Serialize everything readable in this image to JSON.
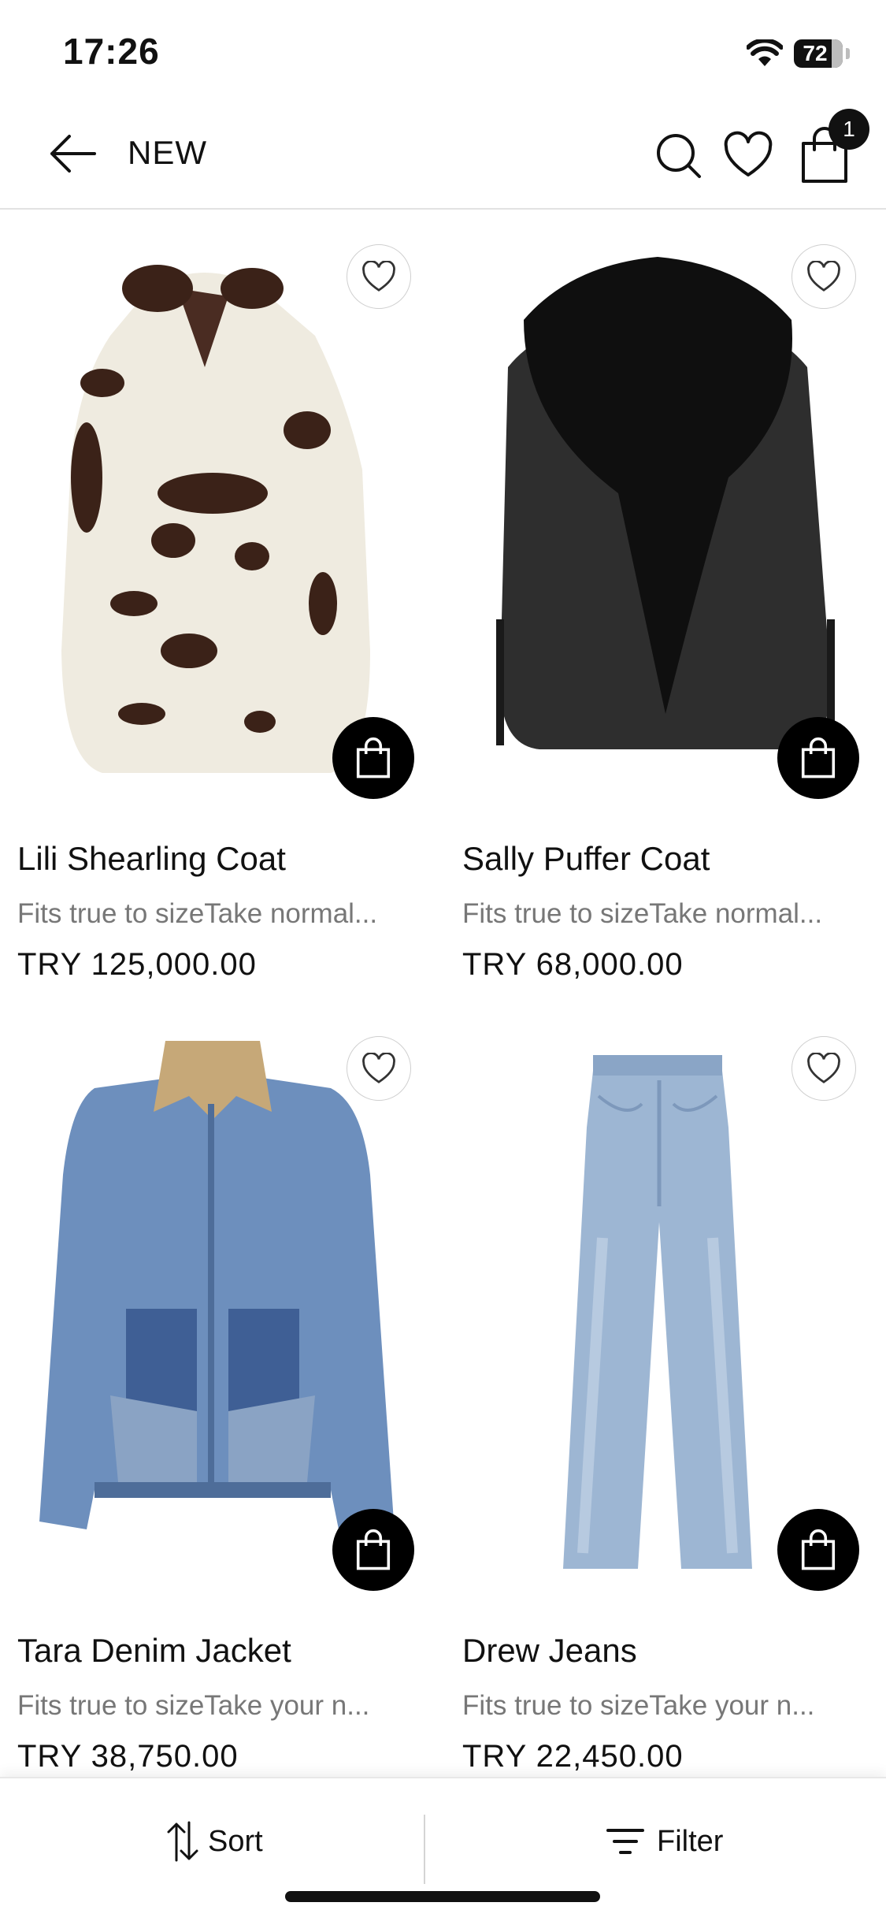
{
  "status": {
    "time": "17:26",
    "battery": "72"
  },
  "nav": {
    "title": "NEW",
    "cart_count": "1"
  },
  "products": [
    {
      "name": "Lili Shearling Coat",
      "desc": "Fits true to sizeTake normal...",
      "price": "TRY 125,000.00"
    },
    {
      "name": "Sally Puffer Coat",
      "desc": "Fits true to sizeTake normal...",
      "price": "TRY 68,000.00"
    },
    {
      "name": "Tara Denim Jacket",
      "desc": "Fits true to sizeTake your n...",
      "price": "TRY 38,750.00"
    },
    {
      "name": "Drew Jeans",
      "desc": "Fits true to sizeTake your n...",
      "price": "TRY 22,450.00"
    }
  ],
  "bottom": {
    "sort_label": "Sort",
    "filter_label": "Filter"
  }
}
